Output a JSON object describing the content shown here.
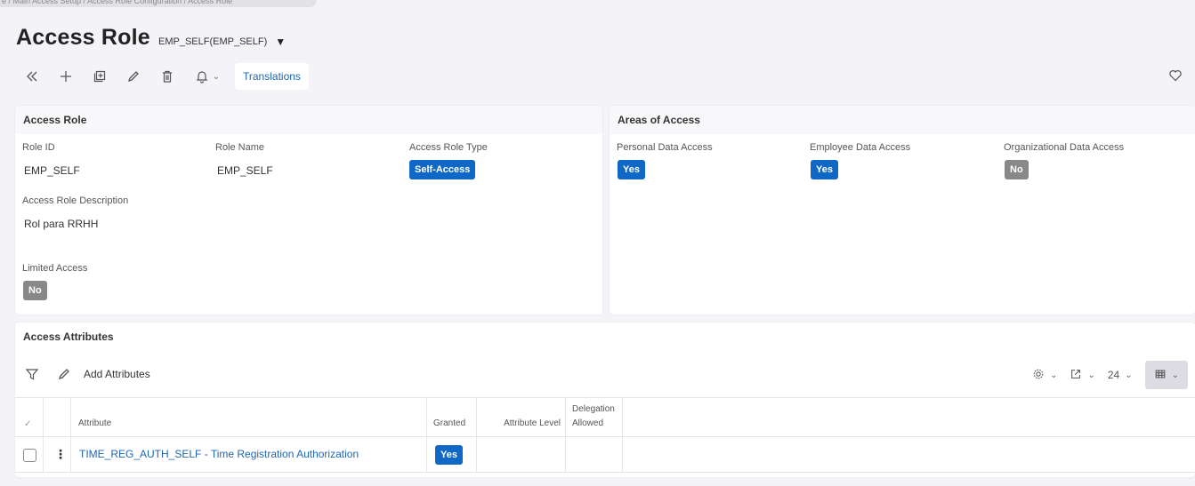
{
  "breadcrumb": "e  /  Main Access Setup  /  Access Role Configuration  /  Access Role",
  "header": {
    "title": "Access Role",
    "subtitle": "EMP_SELF(EMP_SELF)",
    "caret": "▼"
  },
  "toolbar": {
    "collapse_icon": "double-chevron-left-icon",
    "add_icon": "plus-icon",
    "duplicate_icon": "duplicate-icon",
    "edit_icon": "pencil-icon",
    "delete_icon": "trash-icon",
    "notify_icon": "bell-icon",
    "translations_label": "Translations",
    "favorite_icon": "heart-icon"
  },
  "access_role_card": {
    "title": "Access Role",
    "role_id_label": "Role ID",
    "role_id_value": "EMP_SELF",
    "role_name_label": "Role Name",
    "role_name_value": "EMP_SELF",
    "type_label": "Access Role Type",
    "type_value": "Self-Access",
    "description_label": "Access Role Description",
    "description_value": "Rol para RRHH",
    "limited_label": "Limited Access",
    "limited_value": "No"
  },
  "areas_card": {
    "title": "Areas of Access",
    "personal_label": "Personal Data Access",
    "personal_value": "Yes",
    "employee_label": "Employee Data Access",
    "employee_value": "Yes",
    "org_label": "Organizational Data Access",
    "org_value": "No"
  },
  "attributes": {
    "title": "Access Attributes",
    "add_label": "Add Attributes",
    "page_size": "24",
    "columns": {
      "attribute": "Attribute",
      "granted": "Granted",
      "level": "Attribute Level",
      "delegation_line1": "Delegation",
      "delegation_line2": "Allowed"
    },
    "rows": [
      {
        "attribute": "TIME_REG_AUTH_SELF - Time Registration Authorization",
        "granted": "Yes",
        "level": "",
        "delegation": ""
      }
    ]
  },
  "colors": {
    "accent_blue": "#0f68c6",
    "link_blue": "#1f66b3",
    "badge_gray": "#888888",
    "background": "#f4f3f7"
  }
}
